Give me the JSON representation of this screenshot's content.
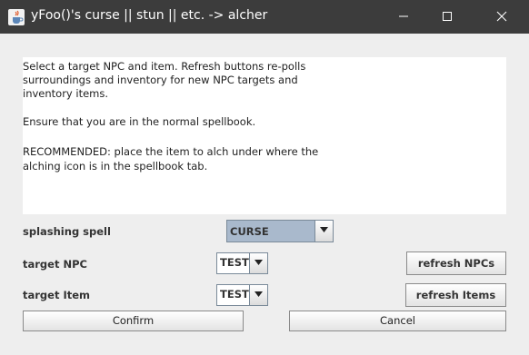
{
  "window": {
    "title": "yFoo()'s curse || stun || etc. -> alcher"
  },
  "instructions": {
    "lines": [
      "Select a target NPC and item. Refresh buttons re-polls",
      "surroundings and inventory for new NPC targets and",
      "inventory items.",
      "Ensure that you are in the normal spellbook.",
      "RECOMMENDED: place the item to alch under where the",
      "alching icon is in the spellbook tab."
    ]
  },
  "form": {
    "spell_label": "splashing spell",
    "spell_value": "CURSE",
    "npc_label": "target NPC",
    "npc_value": "TEST",
    "item_label": "target Item",
    "item_value": "TEST",
    "refresh_npcs_label": "refresh NPCs",
    "refresh_items_label": "refresh Items",
    "confirm_label": "Confirm",
    "cancel_label": "Cancel"
  },
  "icons": {
    "app": "java-cup-icon",
    "minimize": "minimize-icon",
    "maximize": "maximize-icon",
    "close": "close-icon",
    "dropdown": "chevron-down-icon"
  },
  "colors": {
    "titlebar": "#3c3c3c",
    "selected_combo": "#a9b9cc",
    "background": "#eeeeee"
  }
}
